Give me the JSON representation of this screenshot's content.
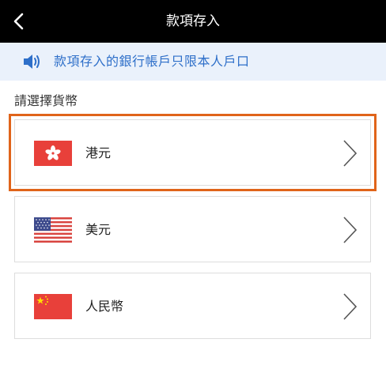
{
  "header": {
    "title": "款項存入",
    "back_icon": "chevron-left-icon"
  },
  "notice": {
    "icon": "speaker-icon",
    "text": "款項存入的銀行帳戶只限本人戶口",
    "color": "#2e6fc9"
  },
  "section": {
    "label": "請選擇貨幣"
  },
  "currencies": [
    {
      "name": "港元",
      "flag": "hong-kong-flag-icon",
      "selected": true
    },
    {
      "name": "美元",
      "flag": "us-flag-icon",
      "selected": false
    },
    {
      "name": "人民幣",
      "flag": "china-flag-icon",
      "selected": false
    }
  ],
  "colors": {
    "header_bg": "#000000",
    "selection_outline": "#e0641a",
    "notice_bg": "#eaf1fb"
  }
}
